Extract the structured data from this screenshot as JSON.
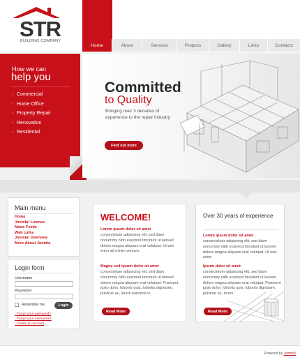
{
  "logo": {
    "name": "STR",
    "tagline": "BUILDING COMPANY"
  },
  "nav": {
    "items": [
      {
        "label": "Home",
        "active": true
      },
      {
        "label": "About"
      },
      {
        "label": "Services"
      },
      {
        "label": "Projects"
      },
      {
        "label": "Gallery"
      },
      {
        "label": "Links"
      },
      {
        "label": "Contacts"
      }
    ]
  },
  "sidebar": {
    "title_small": "How we can",
    "title_big": "help you",
    "items": [
      "Commercial",
      "Home Office",
      "Property Repair",
      "Renovation",
      "Residental"
    ]
  },
  "hero": {
    "headline": "Committed",
    "subheadline": "to Quality",
    "text": "Bringing over 3 decades of experience to the repair industry",
    "button": "Find out more"
  },
  "main_menu": {
    "title": "Main menu",
    "items": [
      "Home",
      "Joomla! License",
      "News Feeds",
      "Web Links",
      "Joomla! Overview",
      "More About Joomla"
    ]
  },
  "login": {
    "title": "Login form",
    "username_label": "Username",
    "password_label": "Password",
    "remember_label": "Remember me",
    "button": "Login",
    "links": [
      "Forgot your password?",
      "Forgot your username?",
      "Create an account"
    ]
  },
  "welcome": {
    "title": "WELCOME!",
    "heading1": "Lorem ipsum dolor sit amet",
    "text1": "consectetuer adipiscing elit, sed diam nonummy nibh euismod tincidunt ut laoreet dolore magna aliquam erat volutpat. Ut wisi enim ad minim veniam.",
    "heading2": "Magna sed ipsum dolor sit amet",
    "text2": "consectetuer adipiscing elit, sed diam nonummy nibh euismod tincidunt ut laoreet dolore magna aliquam erat volutpat. Praesent justo dolor, lobortis quis, lobortis dignissim, pulvinar ac, lorem euismod in.",
    "button": "Read More"
  },
  "experience": {
    "title": "Over 30 years of experience",
    "heading1": "Lorem ipsum dolor sit amet",
    "text1": "consectetuer adipiscing elit, sed diam nonummy nibh euismod tincidunt ut laoreet dolore magna aliquam erat volutpat. Ut wisi enim.",
    "heading2": "Ipsum dolor sit amet",
    "text2": "consectetuer adipiscing elit, sed diam nonummy nibh euismod tincidunt ut laoreet dolore magna aliquam erat volutpat. Praesent justo dolor, lobortis quis, lobortis dignissim, pulvinar ac, lorem.",
    "button": "Read More"
  },
  "footer": {
    "powered_by": "Powered by",
    "link": "Joomla!"
  },
  "colors": {
    "accent": "#c8101a",
    "background": "#f1f1f1",
    "nav": "#e9e9e9"
  }
}
